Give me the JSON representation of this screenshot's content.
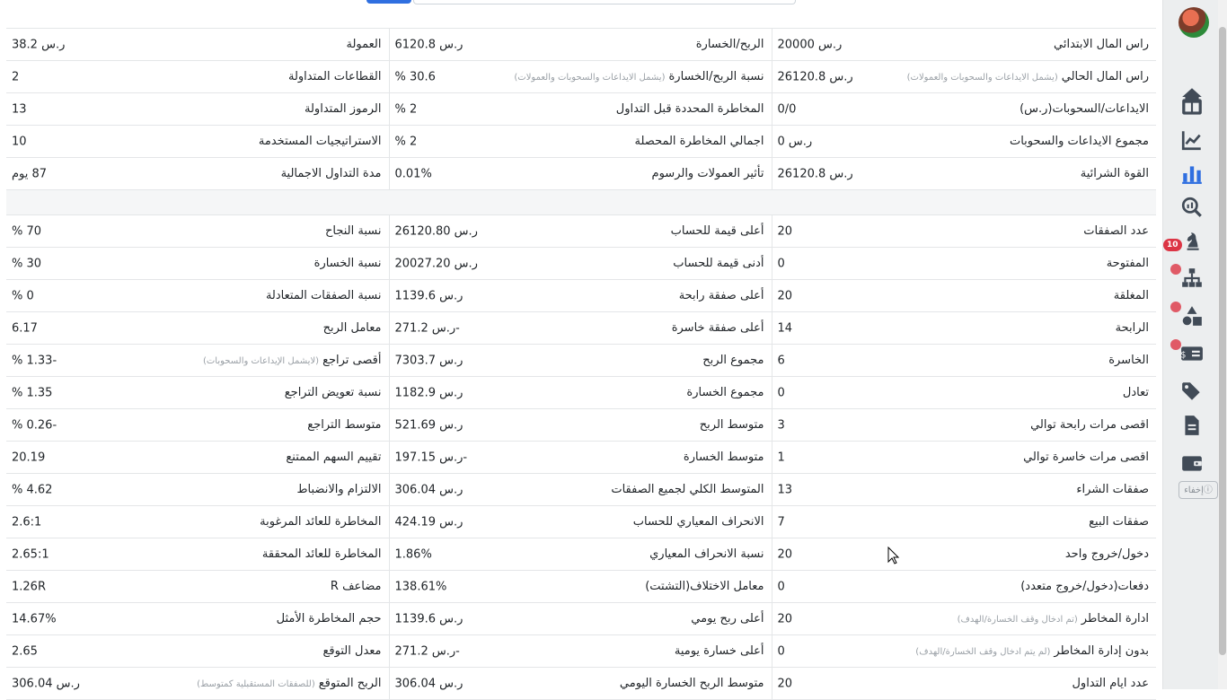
{
  "sidebar": {
    "icons": [
      "home-icon",
      "columns-icon",
      "line-chart-icon",
      "bar-chart-icon",
      "magnify-chart-icon",
      "chess-knight-icon",
      "sitemap-icon",
      "shapes-icon",
      "money-check-icon",
      "tags-icon",
      "file-icon",
      "wallet-icon"
    ],
    "badge": "10",
    "hide_label": "ⓘإخفاء",
    "accent": "#2f6fe0"
  },
  "summary": {
    "rows": [
      {
        "l1": "راس المال الابتدائي",
        "n1": "",
        "v1": "ر.س 20000",
        "l2": "الربح/الخسارة",
        "n2": "",
        "v2": "ر.س 6120.8",
        "l3": "العمولة",
        "n3": "",
        "v3": "ر.س 38.2"
      },
      {
        "l1": "راس المال الحالي",
        "n1": "(يشمل الايداعات والسحوبات والعمولات)",
        "v1": "ر.س 26120.8",
        "l2": "نسبة الربح/الخسارة",
        "n2": "(يشمل الايداعات والسحوبات والعمولات)",
        "v2": "30.6 %",
        "l3": "القطاعات المتداولة",
        "n3": "",
        "v3": "2"
      },
      {
        "l1": "الايداعات/السحوبات(ر.س)",
        "n1": "",
        "v1": "0/0",
        "l2": "المخاطرة المحددة قبل التداول",
        "n2": "",
        "v2": "2 %",
        "l3": "الرموز المتداولة",
        "n3": "",
        "v3": "13"
      },
      {
        "l1": "مجموع الايداعات والسحوبات",
        "n1": "",
        "v1": "ر.س 0",
        "l2": "اجمالي المخاطرة المحصلة",
        "n2": "",
        "v2": "2 %",
        "l3": "الاستراتيجيات المستخدمة",
        "n3": "",
        "v3": "10"
      },
      {
        "l1": "القوة الشرائية",
        "n1": "",
        "v1": "ر.س 26120.8",
        "l2": "تأثير العمولات والرسوم",
        "n2": "",
        "v2": "0.01%",
        "l3": "مدة التداول الاجمالية",
        "n3": "",
        "v3": "87 يوم"
      }
    ]
  },
  "stats": {
    "rows": [
      {
        "l1": "عدد الصفقات",
        "n1": "",
        "v1": "20",
        "l2": "أعلى قيمة للحساب",
        "n2": "",
        "v2": "ر.س 26120.80",
        "l3": "نسبة النجاح",
        "n3": "",
        "v3": "70 %"
      },
      {
        "l1": "المفتوحة",
        "n1": "",
        "v1": "0",
        "l2": "أدنى قيمة للحساب",
        "n2": "",
        "v2": "ر.س 20027.20",
        "l3": "نسبة الخسارة",
        "n3": "",
        "v3": "30 %"
      },
      {
        "l1": "المغلقة",
        "n1": "",
        "v1": "20",
        "l2": "أعلى صفقة رابحة",
        "n2": "",
        "v2": "ر.س 1139.6",
        "l3": "نسبة الصفقات المتعادلة",
        "n3": "",
        "v3": "0 %"
      },
      {
        "l1": "الرابحة",
        "n1": "",
        "v1": "14",
        "l2": "أعلى صفقة خاسرة",
        "n2": "",
        "v2": "-ر.س 271.2",
        "l3": "معامل الربح",
        "n3": "",
        "v3": "6.17"
      },
      {
        "l1": "الخاسرة",
        "n1": "",
        "v1": "6",
        "l2": "مجموع الربح",
        "n2": "",
        "v2": "ر.س 7303.7",
        "l3": "أقصى تراجع",
        "n3": "(لايشمل الإيداعات والسحوبات)",
        "v3": "-1.33 %"
      },
      {
        "l1": "تعادل",
        "n1": "",
        "v1": "0",
        "l2": "مجموع الخسارة",
        "n2": "",
        "v2": "ر.س 1182.9",
        "l3": "نسبة تعويض التراجع",
        "n3": "",
        "v3": "1.35 %"
      },
      {
        "l1": "اقصى مرات رابحة توالي",
        "n1": "",
        "v1": "3",
        "l2": "متوسط الربح",
        "n2": "",
        "v2": "ر.س 521.69",
        "l3": "متوسط التراجع",
        "n3": "",
        "v3": "-0.26 %"
      },
      {
        "l1": "اقصى مرات خاسرة توالي",
        "n1": "",
        "v1": "1",
        "l2": "متوسط الخسارة",
        "n2": "",
        "v2": "-ر.س 197.15",
        "l3": "تقييم السهم الممتنع",
        "n3": "",
        "v3": "20.19"
      },
      {
        "l1": "صفقات الشراء",
        "n1": "",
        "v1": "13",
        "l2": "المتوسط الكلي لجميع الصفقات",
        "n2": "",
        "v2": "ر.س 306.04",
        "l3": "الالتزام والانضباط",
        "n3": "",
        "v3": "4.62 %"
      },
      {
        "l1": "صفقات البيع",
        "n1": "",
        "v1": "7",
        "l2": "الانحراف المعياري للحساب",
        "n2": "",
        "v2": "ر.س 424.19",
        "l3": "المخاطرة للعائد المرغوبة",
        "n3": "",
        "v3": "2.6:1"
      },
      {
        "l1": "دخول/خروج واحد",
        "n1": "",
        "v1": "20",
        "l2": "نسبة الانحراف المعياري",
        "n2": "",
        "v2": "1.86%",
        "l3": "المخاطرة للعائد المحققة",
        "n3": "",
        "v3": "2.65:1"
      },
      {
        "l1": "دفعات(دخول/خروج متعدد)",
        "n1": "",
        "v1": "0",
        "l2": "معامل الاختلاف(التشتت)",
        "n2": "",
        "v2": "138.61%",
        "l3": "مضاعف R",
        "n3": "",
        "v3": "1.26R"
      },
      {
        "l1": "ادارة المخاطر",
        "n1": "(تم ادخال وقف الخسارة/الهدف)",
        "v1": "20",
        "l2": "أعلى ربح يومي",
        "n2": "",
        "v2": "ر.س 1139.6",
        "l3": "حجم المخاطرة الأمثل",
        "n3": "",
        "v3": "14.67%"
      },
      {
        "l1": "بدون إدارة المخاطر",
        "n1": "(لم يتم ادخال وقف الخسارة/الهدف)",
        "v1": "0",
        "l2": "أعلى خسارة يومية",
        "n2": "",
        "v2": "-ر.س 271.2",
        "l3": "معدل التوقع",
        "n3": "",
        "v3": "2.65"
      },
      {
        "l1": "عدد ايام التداول",
        "n1": "",
        "v1": "20",
        "l2": "متوسط الربح الخسارة اليومي",
        "n2": "",
        "v2": "ر.س 306.04",
        "l3": "الربح المتوقع",
        "n3": "(للصفقات المستقبلية كمتوسط)",
        "v3": "ر.س 306.04"
      }
    ]
  }
}
